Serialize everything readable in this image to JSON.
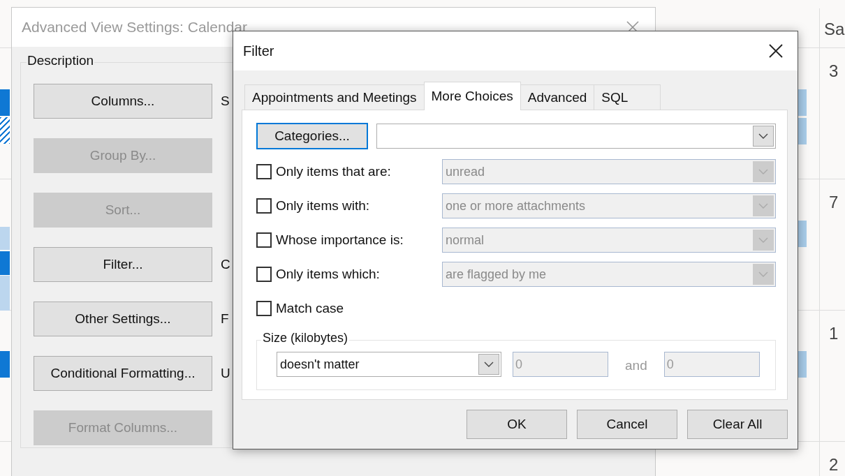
{
  "calendar": {
    "headers": [
      "Sa"
    ],
    "dates": [
      "3",
      "7",
      "1",
      "2"
    ]
  },
  "advanced_dialog": {
    "title": "Advanced View Settings: Calendar",
    "group_label": "Description",
    "buttons": [
      {
        "label": "Columns...",
        "disabled": false,
        "description": "S"
      },
      {
        "label": "Group By...",
        "disabled": true
      },
      {
        "label": "Sort...",
        "disabled": true
      },
      {
        "label": "Filter...",
        "disabled": false,
        "description": "C"
      },
      {
        "label": "Other Settings...",
        "disabled": false,
        "description": "F"
      },
      {
        "label": "Conditional Formatting...",
        "disabled": false,
        "description": "U"
      },
      {
        "label": "Format Columns...",
        "disabled": true
      }
    ]
  },
  "filter_dialog": {
    "title": "Filter",
    "tabs": [
      {
        "label": "Appointments and Meetings",
        "selected": false
      },
      {
        "label": "More Choices",
        "selected": true
      },
      {
        "label": "Advanced",
        "selected": false
      },
      {
        "label": "SQL",
        "selected": false
      }
    ],
    "categories_button": "Categories...",
    "rows": [
      {
        "kind": "dropdown",
        "label": "Only items that are:",
        "checked": false,
        "value": "unread",
        "disabled": true
      },
      {
        "kind": "dropdown",
        "label": "Only items with:",
        "checked": false,
        "value": "one or more attachments",
        "disabled": true
      },
      {
        "kind": "dropdown",
        "label": "Whose importance is:",
        "checked": false,
        "value": "normal",
        "disabled": true
      },
      {
        "kind": "dropdown",
        "label": "Only items which:",
        "checked": false,
        "value": "are flagged by me",
        "disabled": true
      },
      {
        "kind": "plain",
        "label": "Match case",
        "checked": false
      }
    ],
    "size": {
      "label": "Size (kilobytes)",
      "condition": "doesn't matter",
      "from": "0",
      "separator": "and",
      "to": "0",
      "disabled": true
    },
    "buttons": [
      "OK",
      "Cancel",
      "Clear All"
    ]
  }
}
